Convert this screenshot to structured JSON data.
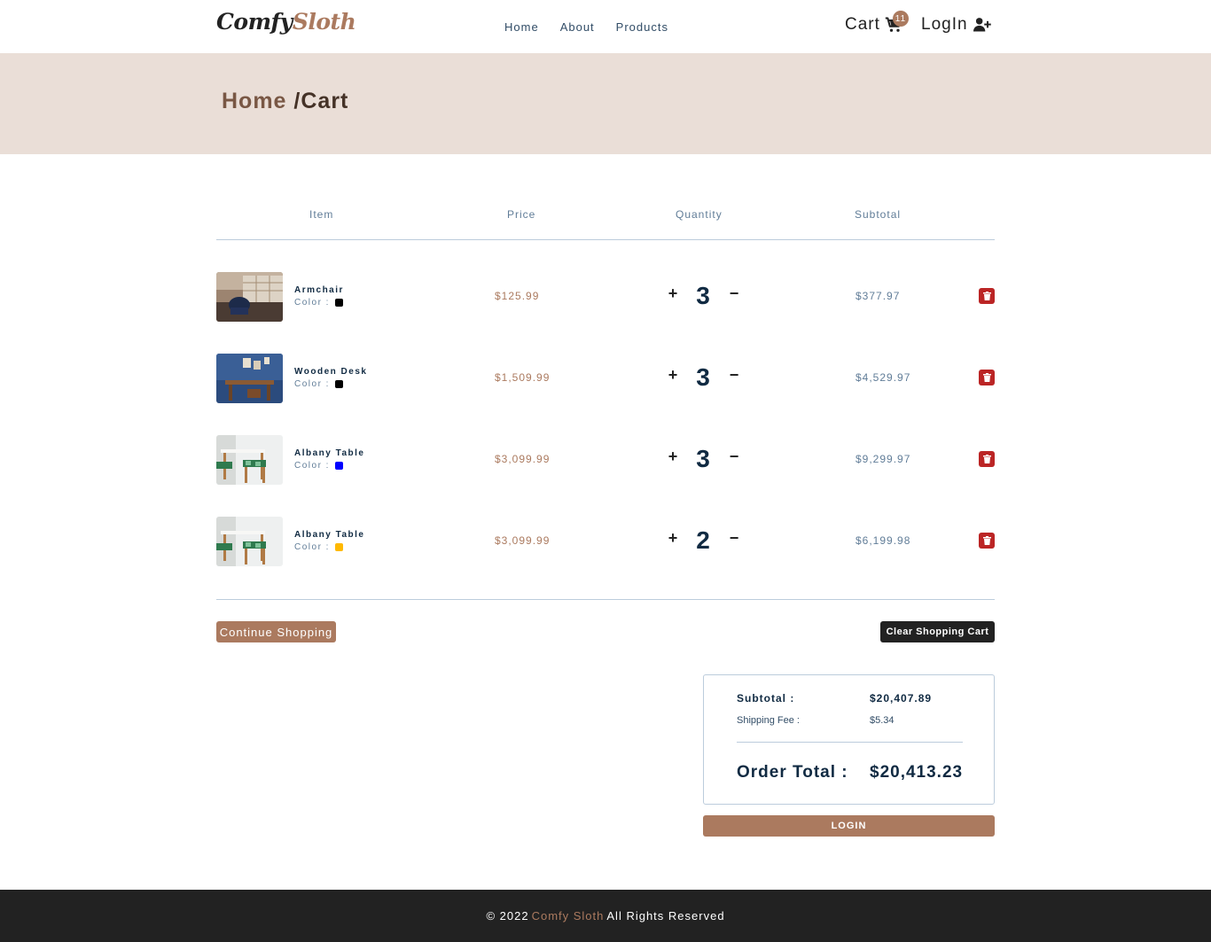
{
  "brand": {
    "part1": "Comfy",
    "part2": "Sloth"
  },
  "nav": {
    "links": [
      "Home",
      "About",
      "Products"
    ]
  },
  "cart": {
    "label": "Cart",
    "count": "11"
  },
  "login": {
    "label": "LogIn"
  },
  "breadcrumb": {
    "home": "Home",
    "current": "/Cart"
  },
  "columns": {
    "item": "Item",
    "price": "Price",
    "quantity": "Quantity",
    "subtotal": "Subtotal"
  },
  "items": [
    {
      "name": "Armchair",
      "color_label": "Color :",
      "color": "#000000",
      "price": "$125.99",
      "quantity": "3",
      "subtotal": "$377.97"
    },
    {
      "name": "Wooden Desk",
      "color_label": "Color :",
      "color": "#000000",
      "price": "$1,509.99",
      "quantity": "3",
      "subtotal": "$4,529.97"
    },
    {
      "name": "Albany Table",
      "color_label": "Color :",
      "color": "#0000ff",
      "price": "$3,099.99",
      "quantity": "3",
      "subtotal": "$9,299.97"
    },
    {
      "name": "Albany Table",
      "color_label": "Color :",
      "color": "#ffb900",
      "price": "$3,099.99",
      "quantity": "2",
      "subtotal": "$6,199.98"
    }
  ],
  "buttons": {
    "continue": "Continue Shopping",
    "clear": "Clear Shopping Cart",
    "login": "LOGIN",
    "plus": "+",
    "minus": "−"
  },
  "totals": {
    "subtotal_label": "Subtotal :",
    "subtotal": "$20,407.89",
    "shipping_label": "Shipping Fee :",
    "shipping": "$5.34",
    "order_label": "Order Total :",
    "order_total": "$20,413.23"
  },
  "footer": {
    "copy": "© 2022",
    "brand": "Comfy Sloth",
    "rights": "All Rights Reserved"
  },
  "colors": {
    "accent": "#ab7a5f",
    "hero_bg": "#eaded7",
    "danger": "#bb2525",
    "dark": "#222222"
  },
  "icons": {
    "cart": "shopping-cart-icon",
    "login": "user-plus-icon",
    "remove": "trash-icon"
  }
}
